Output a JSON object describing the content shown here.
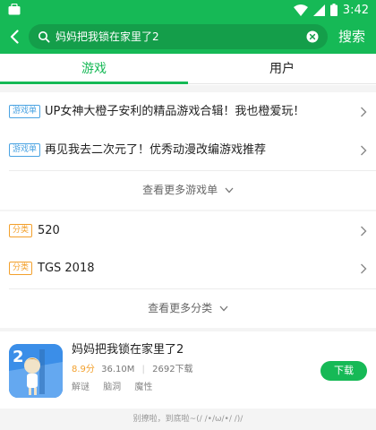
{
  "status_bar": {
    "time": "3:42"
  },
  "search": {
    "query": "妈妈把我锁在家里了2",
    "button_label": "搜索"
  },
  "tabs": [
    {
      "label": "游戏"
    },
    {
      "label": "用户"
    }
  ],
  "game_lists": [
    {
      "badge": "游戏单",
      "title": "UP女神大橙子安利的精品游戏合辑！我也橙爱玩！"
    },
    {
      "badge": "游戏单",
      "title": "再见我去二次元了！优秀动漫改编游戏推荐"
    }
  ],
  "more_game_lists": "查看更多游戏单",
  "categories": [
    {
      "badge": "分类",
      "title": "520"
    },
    {
      "badge": "分类",
      "title": "TGS 2018"
    }
  ],
  "more_categories": "查看更多分类",
  "app": {
    "name": "妈妈把我锁在家里了2",
    "score": "8.9分",
    "size": "36.10M",
    "downloads": "2692下载",
    "tags": [
      "解谜",
      "脑洞",
      "魔性"
    ],
    "download_label": "下载",
    "icon_text": "2"
  },
  "footer_text": "别撩啦，到底啦~(/ /•/ω/•/ /)/",
  "colors": {
    "accent": "#16b956",
    "badge_blue": "#4aa3e2",
    "badge_orange": "#f3a02c"
  },
  "icons": {
    "status_left": "notification-icon",
    "status_right": [
      "wifi-icon",
      "signal-icon",
      "battery-icon"
    ],
    "back": "back-arrow-icon",
    "search": "search-icon",
    "clear": "clear-icon",
    "row_arrow": "chevron-right-icon",
    "more_arrow": "chevron-down-icon"
  }
}
